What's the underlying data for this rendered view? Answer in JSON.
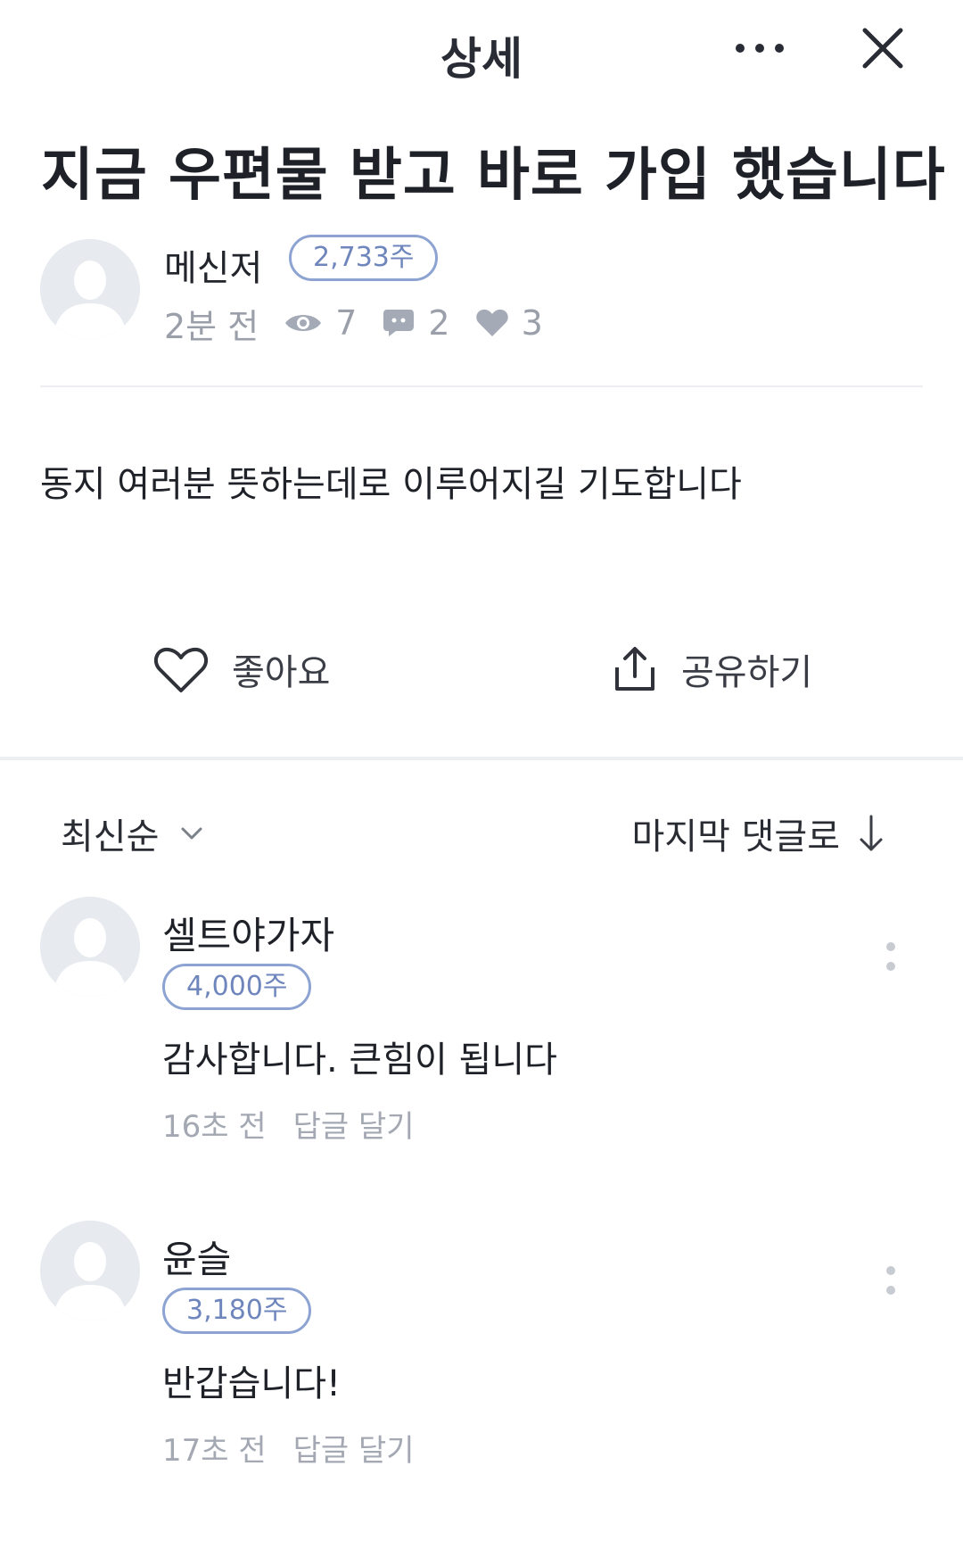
{
  "header": {
    "title": "상세",
    "more_icon": "more-horizontal-icon",
    "close_icon": "close-icon"
  },
  "post": {
    "title": "지금 우편물 받고 바로 가입 했습니다",
    "author": {
      "name": "메신저",
      "shares": "2,733주"
    },
    "time": "2분 전",
    "views": "7",
    "comments": "2",
    "likes": "3",
    "body": "동지 여러분 뜻하는데로 이루어지길 기도합니다"
  },
  "actions": {
    "like_label": "좋아요",
    "share_label": "공유하기"
  },
  "comment_bar": {
    "sort_label": "최신순",
    "jump_label": "마지막 댓글로"
  },
  "comments": [
    {
      "name": "셀트야가자",
      "shares": "4,000주",
      "text": "감사합니다. 큰힘이 됩니다",
      "time": "16초 전",
      "reply": "답글 달기"
    },
    {
      "name": "윤슬",
      "shares": "3,180주",
      "text": "반갑습니다!",
      "time": "17초 전",
      "reply": "답글 달기"
    }
  ],
  "colors": {
    "accent": "#8da3d2",
    "muted": "#9a9fa9",
    "divider": "#eceef2"
  }
}
